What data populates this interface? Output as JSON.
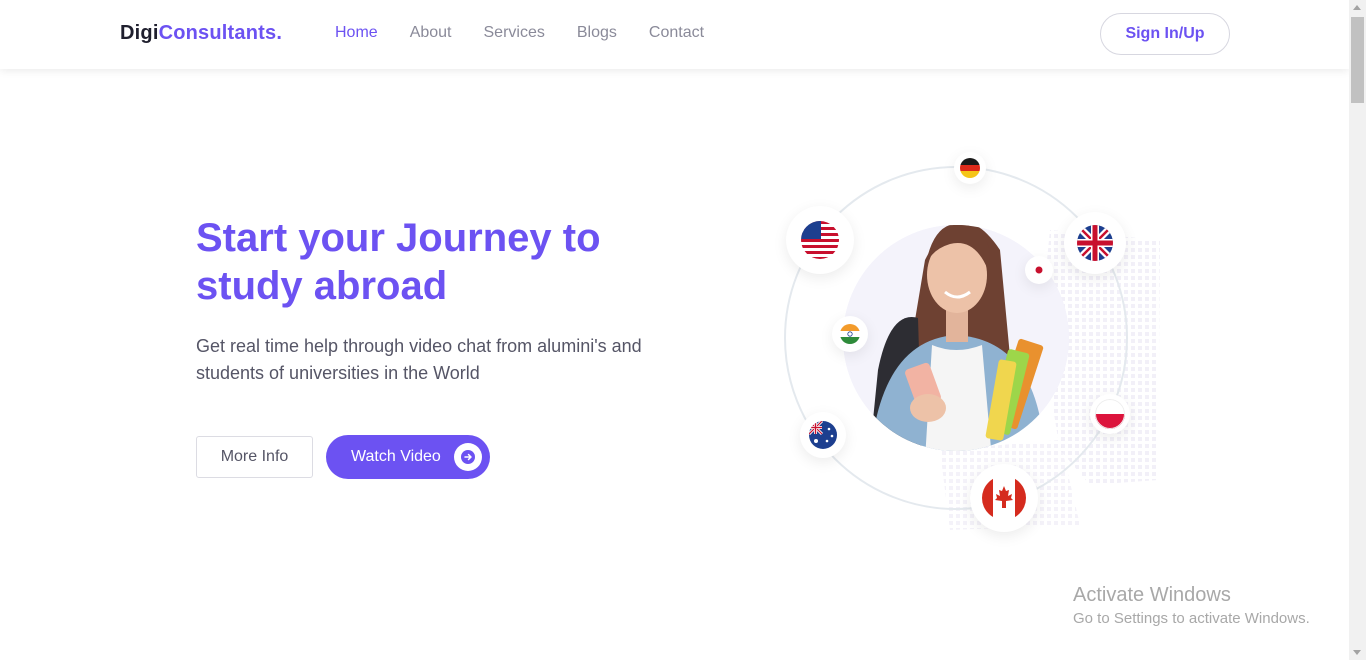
{
  "brand": {
    "part1": "Digi",
    "part2": "Consultants."
  },
  "nav": {
    "items": [
      "Home",
      "About",
      "Services",
      "Blogs",
      "Contact"
    ],
    "active": "Home"
  },
  "header": {
    "signin_label": "Sign In/Up"
  },
  "hero": {
    "title": "Start your Journey to study abroad",
    "subtitle": "Get real time help through video chat from alumini's and students of universities in the World",
    "more_info_label": "More Info",
    "watch_video_label": "Watch Video"
  },
  "illustration": {
    "flags": [
      "germany-flag-icon",
      "usa-flag-icon",
      "uk-flag-icon",
      "japan-flag-icon",
      "india-flag-icon",
      "poland-flag-icon",
      "australia-flag-icon",
      "canada-flag-icon"
    ],
    "accent": "#6c52f2"
  },
  "watermark": {
    "title": "Activate Windows",
    "subtitle": "Go to Settings to activate Windows."
  },
  "colors": {
    "accent": "#6c52f2",
    "text_dark": "#1f1f2e",
    "text_muted": "#8a8a99"
  }
}
